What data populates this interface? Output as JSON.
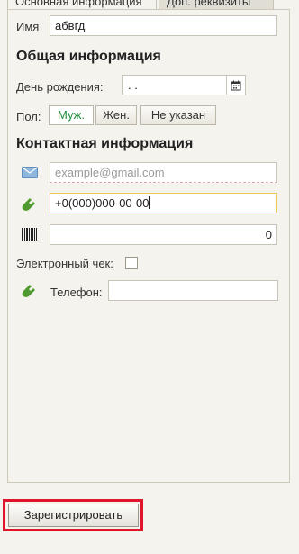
{
  "tabs": {
    "main": "Основная информация",
    "extra": "Доп. реквизиты"
  },
  "name": {
    "label": "Имя",
    "value": "абвгд"
  },
  "general": {
    "heading": "Общая информация",
    "birthday_label": "День рождения:",
    "birthday_value": ". .",
    "gender_label": "Пол:",
    "gender_options": [
      "Муж.",
      "Жен.",
      "Не указан"
    ],
    "gender_selected": "Муж."
  },
  "contact": {
    "heading": "Контактная информация",
    "email_placeholder": "example@gmail.com",
    "phone_value": "+0(000)000-00-00",
    "barcode_value": "0",
    "echeck_label": "Электронный чек:",
    "phone2_label": "Телефон:",
    "phone2_value": ""
  },
  "actions": {
    "register_label": "Зарегистрировать"
  },
  "colors": {
    "selected_gender": "#1d8a3a",
    "highlight": "#e0142a",
    "focus_border": "#e8c95a"
  }
}
